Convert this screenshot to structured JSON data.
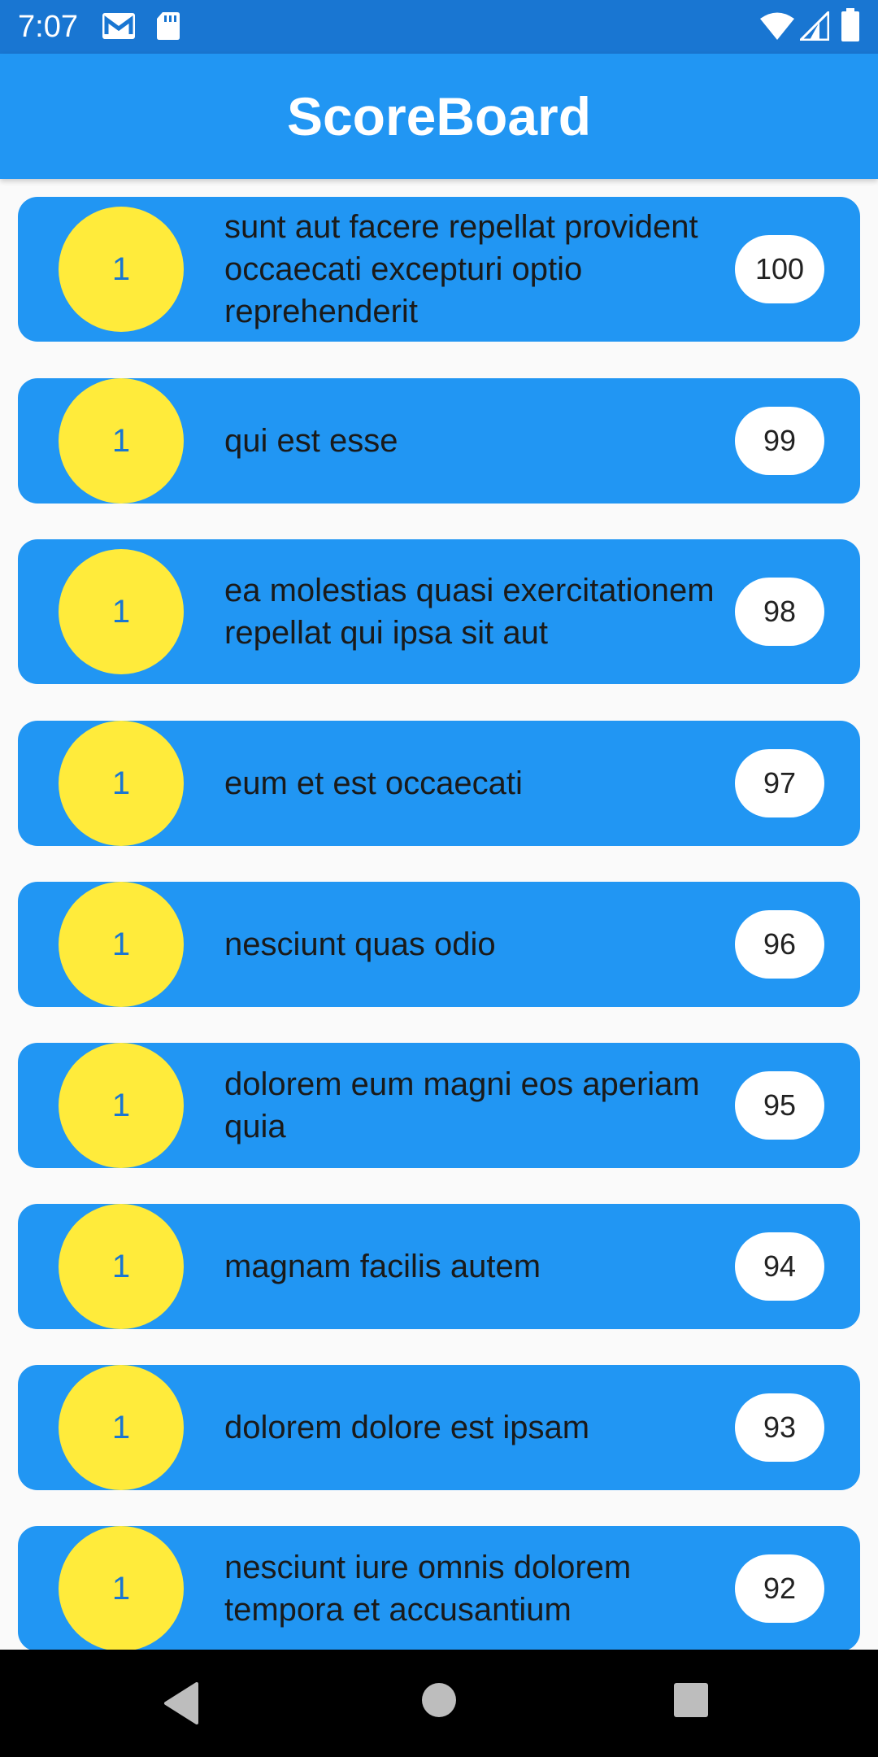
{
  "status_bar": {
    "time": "7:07",
    "icons": [
      "gmail-icon",
      "sd-card-icon",
      "wifi-icon",
      "signal-icon",
      "battery-icon"
    ]
  },
  "app_bar": {
    "title": "ScoreBoard"
  },
  "colors": {
    "status_bar": "#1976d2",
    "app_bar": "#2196f3",
    "card": "#2196f3",
    "rank_circle": "#ffeb3b",
    "rank_text": "#1976d2",
    "score_pill": "#ffffff",
    "background": "#fafafa",
    "nav_bar": "#000000"
  },
  "entries": [
    {
      "rank": "1",
      "title": "sunt aut facere repellat provident occaecati excepturi optio reprehenderit",
      "score": "100"
    },
    {
      "rank": "1",
      "title": "qui est esse",
      "score": "99"
    },
    {
      "rank": "1",
      "title": "ea molestias quasi exercitationem repellat qui ipsa sit aut",
      "score": "98"
    },
    {
      "rank": "1",
      "title": "eum et est occaecati",
      "score": "97"
    },
    {
      "rank": "1",
      "title": "nesciunt quas odio",
      "score": "96"
    },
    {
      "rank": "1",
      "title": "dolorem eum magni eos aperiam quia",
      "score": "95"
    },
    {
      "rank": "1",
      "title": "magnam facilis autem",
      "score": "94"
    },
    {
      "rank": "1",
      "title": "dolorem dolore est ipsam",
      "score": "93"
    },
    {
      "rank": "1",
      "title": "nesciunt iure omnis dolorem tempora et accusantium",
      "score": "92"
    }
  ],
  "nav_bar": {
    "buttons": [
      "back-icon",
      "home-icon",
      "recents-icon"
    ]
  }
}
